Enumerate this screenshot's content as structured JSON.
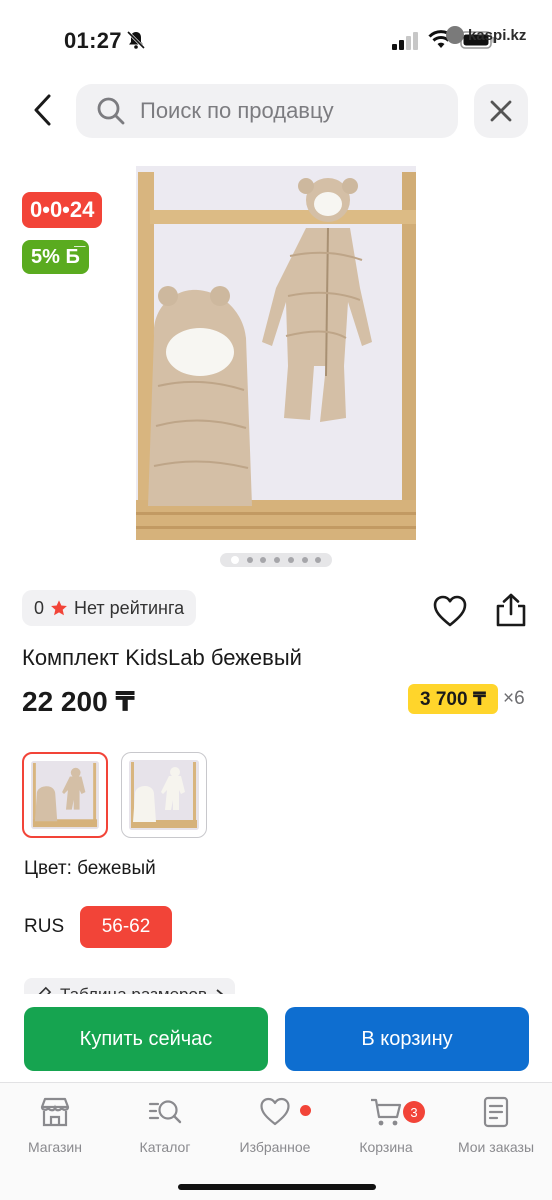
{
  "status_bar": {
    "time": "01:27",
    "watermark": "kaspi.kz"
  },
  "header": {
    "search_placeholder": "Поиск по продавцу"
  },
  "badges": {
    "timer": "0•0•24",
    "cashback": "5% Б̅"
  },
  "gallery": {
    "pages": 7,
    "current": 1
  },
  "rating": {
    "score": "0",
    "text": "Нет рейтинга"
  },
  "product": {
    "title": "Комплект KidsLab бежевый",
    "price": "22 200 ₸",
    "installment_price": "3 700 ₸",
    "installment_months": "×6"
  },
  "options": {
    "color_label": "Цвет: бежевый",
    "size_system": "RUS",
    "size_selected": "56-62",
    "size_table_label": "Таблица размеров"
  },
  "actions": {
    "buy_now": "Купить сейчас",
    "add_to_cart": "В корзину"
  },
  "tabs": [
    {
      "label": "Магазин",
      "icon": "store-icon"
    },
    {
      "label": "Каталог",
      "icon": "catalog-search-icon"
    },
    {
      "label": "Избранное",
      "icon": "heart-icon"
    },
    {
      "label": "Корзина",
      "icon": "cart-icon"
    },
    {
      "label": "Мои заказы",
      "icon": "orders-icon"
    }
  ],
  "cart_count": "3",
  "colors": {
    "accent_red": "#f24438",
    "cashback_green": "#5aab1f",
    "buy_green": "#16a450",
    "cart_blue": "#0e6ed0",
    "installment_yellow": "#ffd52b"
  }
}
